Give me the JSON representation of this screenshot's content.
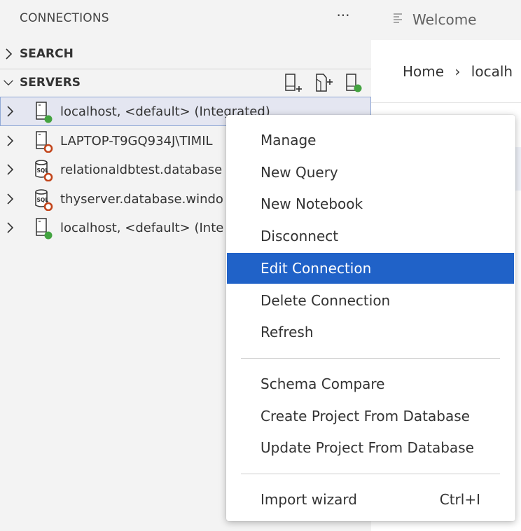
{
  "sidebar": {
    "title": "CONNECTIONS",
    "more_label": "···",
    "search_section": {
      "label": "SEARCH"
    },
    "servers_section": {
      "label": "SERVERS",
      "actions": [
        {
          "name": "new-connection",
          "icon": "server-plus-icon"
        },
        {
          "name": "new-server-group",
          "icon": "folder-plus-icon"
        },
        {
          "name": "active-connections",
          "icon": "server-status-icon"
        }
      ]
    },
    "servers": [
      {
        "label": "localhost, <default> (Integrated)",
        "icon": "server-icon",
        "status": "connected",
        "selected": true
      },
      {
        "label": "LAPTOP-T9GQ934J\\TIMIL",
        "icon": "server-icon",
        "status": "disconnected",
        "selected": false
      },
      {
        "label": "relationaldbtest.database",
        "icon": "sql-database-icon",
        "status": "disconnected",
        "selected": false
      },
      {
        "label": "thyserver.database.windo",
        "icon": "sql-database-icon",
        "status": "disconnected",
        "selected": false
      },
      {
        "label": "localhost, <default> (Inte",
        "icon": "server-icon",
        "status": "connected",
        "selected": false
      }
    ]
  },
  "editor": {
    "tab_label": "Welcome",
    "breadcrumb": {
      "home": "Home",
      "current": "localh"
    }
  },
  "context_menu": {
    "items": [
      {
        "label": "Manage"
      },
      {
        "label": "New Query"
      },
      {
        "label": "New Notebook"
      },
      {
        "label": "Disconnect"
      },
      {
        "label": "Edit Connection",
        "active": true
      },
      {
        "label": "Delete Connection"
      },
      {
        "label": "Refresh"
      },
      {
        "label": "Schema Compare"
      },
      {
        "label": "Create Project From Database"
      },
      {
        "label": "Update Project From Database"
      },
      {
        "label": "Import wizard",
        "shortcut": "Ctrl+I"
      }
    ]
  },
  "colors": {
    "connected": "#43a340",
    "disconnected": "#c2451b",
    "menu_highlight": "#2062c8",
    "sidebar_bg": "#f3f3f3"
  }
}
